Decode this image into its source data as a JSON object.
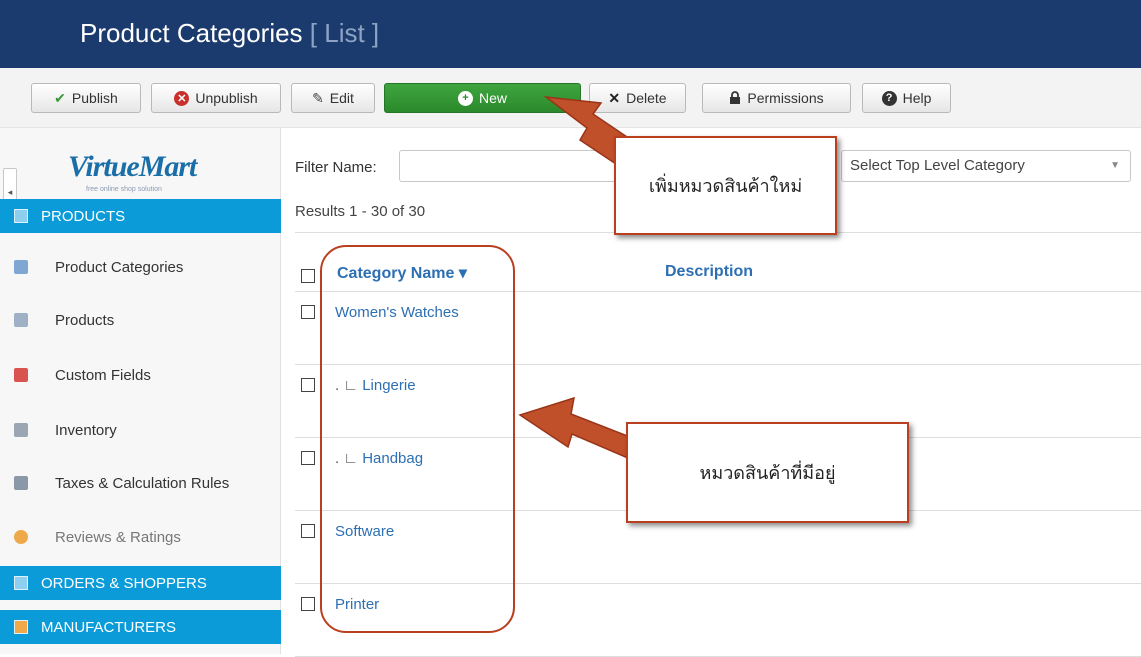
{
  "header": {
    "title": "Product Categories",
    "title_suffix": "[ List ]"
  },
  "toolbar": {
    "publish": "Publish",
    "unpublish": "Unpublish",
    "edit": "Edit",
    "new": "New",
    "delete": "Delete",
    "permissions": "Permissions",
    "help": "Help"
  },
  "sidebar": {
    "logo_text": "VirtueMart",
    "logo_tagline": "free online shop solution",
    "collapse_glyph": "◂",
    "sections": {
      "products": "PRODUCTS",
      "orders": "ORDERS & SHOPPERS",
      "manufacturers": "MANUFACTURERS"
    },
    "items": [
      {
        "label": "Product Categories",
        "icon": "folder-icon",
        "color": "#7fa7d1"
      },
      {
        "label": "Products",
        "icon": "products-icon",
        "color": "#9fb1c4"
      },
      {
        "label": "Custom Fields",
        "icon": "custom-fields-icon",
        "color": "#d9534f"
      },
      {
        "label": "Inventory",
        "icon": "inventory-icon",
        "color": "#9aa7b3"
      },
      {
        "label": "Taxes & Calculation Rules",
        "icon": "calculator-icon",
        "color": "#8a98a8"
      },
      {
        "label": "Reviews & Ratings",
        "icon": "reviews-icon",
        "color": "#f0a94a"
      }
    ]
  },
  "filter": {
    "label": "Filter Name:",
    "value": "",
    "top_level": "Select Top Level Category"
  },
  "results": "Results 1 - 30 of 30",
  "table": {
    "col_name": "Category Name",
    "sort_glyph": "▾",
    "col_desc": "Description",
    "rows": [
      {
        "prefix": "",
        "name": "Women's Watches"
      },
      {
        "prefix": ". ∟ ",
        "name": "Lingerie"
      },
      {
        "prefix": ". ∟ ",
        "name": "Handbag"
      },
      {
        "prefix": "",
        "name": "Software"
      },
      {
        "prefix": "",
        "name": "Printer"
      }
    ]
  },
  "callouts": {
    "new_category": "เพิ่มหมวดสินค้าใหม่",
    "existing": "หมวดสินค้าที่มีอยู่"
  },
  "colors": {
    "header": "#1b3a6d",
    "accent": "#0a9bd8",
    "link": "#2d6fb3",
    "annotation": "#b93f1f",
    "new_button": "#3ea53e"
  }
}
